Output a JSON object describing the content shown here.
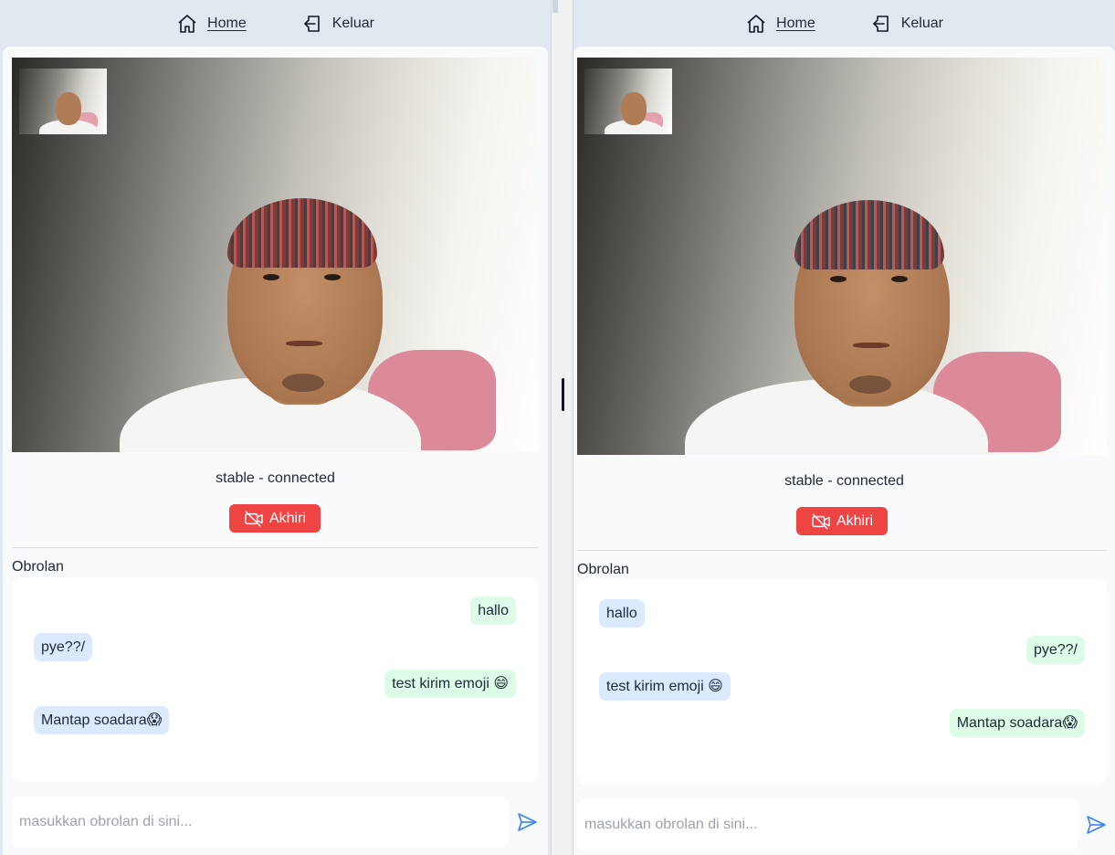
{
  "nav": {
    "home_label": "Home",
    "logout_label": "Keluar"
  },
  "call": {
    "status": "stable - connected",
    "end_label": "Akhiri"
  },
  "chat": {
    "title": "Obrolan",
    "placeholder": "masukkan obrolan di sini...",
    "left_messages": [
      {
        "text": "hallo",
        "from": "me"
      },
      {
        "text": "pye??/",
        "from": "them"
      },
      {
        "text": "test kirim emoji 😄",
        "from": "me"
      },
      {
        "text": "Mantap soadara😱",
        "from": "them"
      }
    ],
    "right_messages": [
      {
        "text": "hallo",
        "from": "them"
      },
      {
        "text": "pye??/",
        "from": "me"
      },
      {
        "text": "test kirim emoji 😄",
        "from": "them"
      },
      {
        "text": "Mantap soadara😱",
        "from": "me"
      }
    ]
  },
  "colors": {
    "end_button": "#ef4444",
    "bubble_mine": "#dcfce7",
    "bubble_theirs": "#dbeafe",
    "send_icon": "#3b82f6"
  },
  "icons": {
    "home": "home-icon",
    "logout": "logout-icon",
    "end_call": "video-off-icon",
    "send": "send-icon"
  }
}
